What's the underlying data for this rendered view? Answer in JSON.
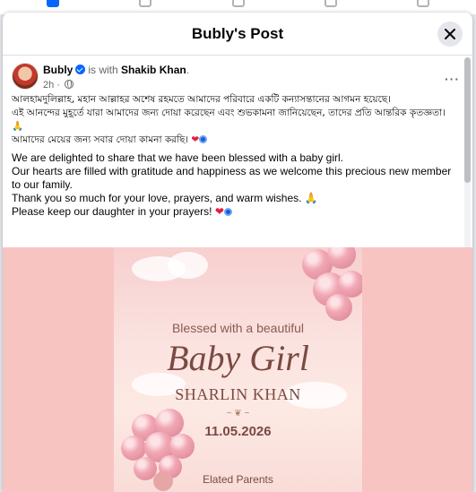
{
  "dialog": {
    "title": "Bubly's Post",
    "close_icon": "close-icon"
  },
  "post": {
    "author": "Bubly",
    "with_text": "is with",
    "tagged": "Shakib Khan",
    "tagged_suffix": ".",
    "time": "2h",
    "time_sep": " ·",
    "privacy_icon": "globe-icon",
    "more_icon": "more-options-icon",
    "more_glyph": "···",
    "body_bn": [
      "আলহামদুলিল্লাহ, মহান আল্লাহর অশেষ রহমতে আমাদের পরিবারে একটি কন্যাসন্তানের আগমন হয়েছে।",
      "এই আনন্দের মুহূর্তে যারা আমাদের জন্য দোয়া করেছেন এবং শুভকামনা জানিয়েছেন, তাদের প্রতি আন্তরিক কৃতজ্ঞতা।",
      "🙏",
      "আমাদের মেয়ের জন্য সবার দোয়া কামনা করছি।"
    ],
    "body_en": [
      "We are delighted to share that we have been blessed with a baby girl.",
      "Our hearts are filled with gratitude and happiness as we welcome this precious new member to our family.",
      "Thank you so much for your love, prayers, and warm wishes.",
      "Please keep our daughter in your prayers!"
    ],
    "heart_glyph": "❤",
    "pray_glyph": "🙏"
  },
  "card": {
    "line1": "Blessed with a beautiful",
    "line2": "Baby Girl",
    "line3": "SHARLIN KHAN",
    "ornament": "~ ❦ ~",
    "line4": "11.05.2026",
    "line5": "Elated Parents"
  },
  "colors": {
    "accent": "#0866ff",
    "photo_bg": "#f7c4c2",
    "card_text": "#7a4a42"
  }
}
